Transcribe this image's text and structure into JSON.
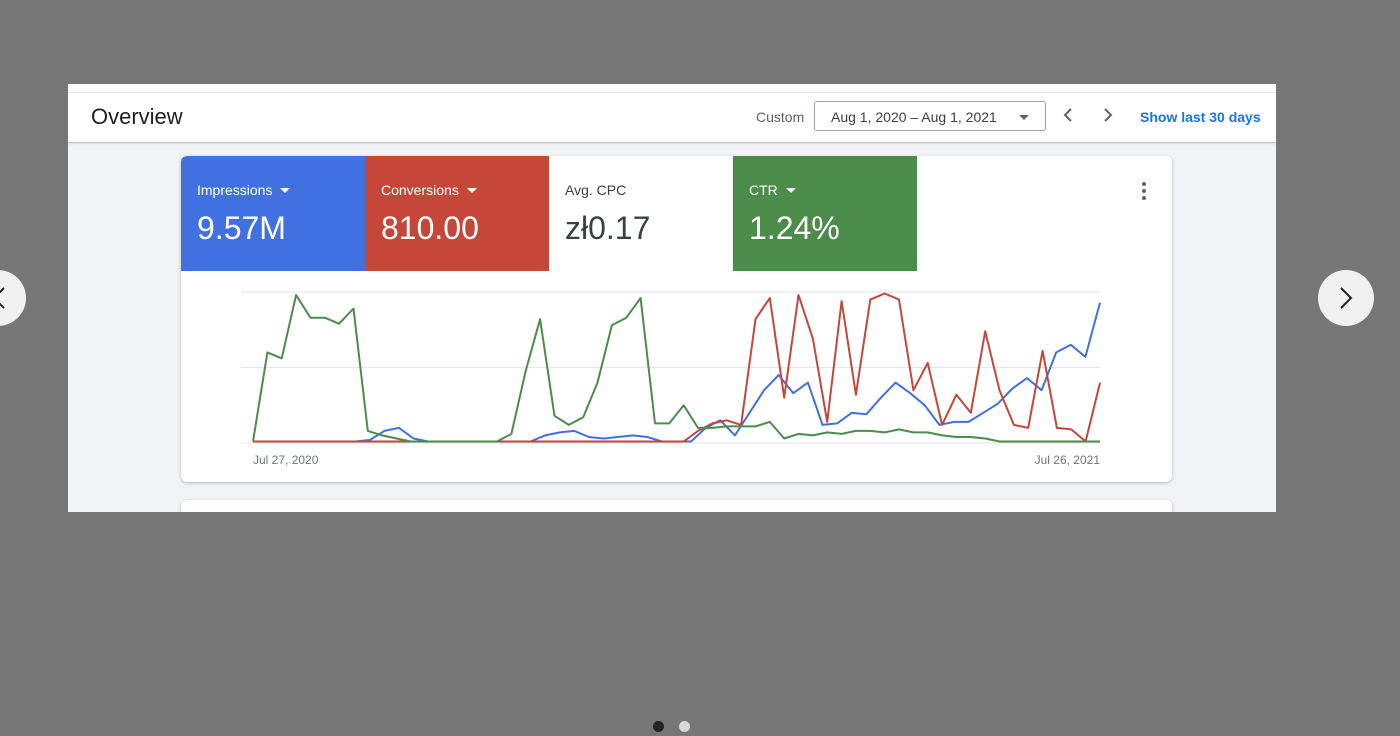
{
  "header": {
    "title": "Overview",
    "custom_label": "Custom",
    "date_range": "Aug 1, 2020 – Aug 1, 2021",
    "show_last": "Show last 30 days"
  },
  "metrics": [
    {
      "label": "Impressions",
      "value": "9.57M",
      "color": "#4170e0",
      "has_dropdown": true
    },
    {
      "label": "Conversions",
      "value": "810.00",
      "color": "#c5473a",
      "has_dropdown": true
    },
    {
      "label": "Avg. CPC",
      "value": "zł0.17",
      "color": "#ffffff",
      "has_dropdown": false
    },
    {
      "label": "CTR",
      "value": "1.24%",
      "color": "#4b8c4a",
      "has_dropdown": true
    }
  ],
  "chart_data": {
    "type": "line",
    "x_start_label": "Jul 27, 2020",
    "x_end_label": "Jul 26, 2021",
    "ylim": [
      0,
      100
    ],
    "grid": true,
    "series": [
      {
        "color": "#4170e0",
        "values": [
          1,
          1,
          1,
          1,
          1,
          1,
          1,
          1,
          2,
          8,
          10,
          3,
          1,
          1,
          1,
          1,
          1,
          1,
          1,
          1,
          5,
          7,
          8,
          4,
          3,
          4,
          5,
          4,
          1,
          1,
          1,
          10,
          15,
          5,
          20,
          35,
          45,
          33,
          40,
          12,
          13,
          20,
          19,
          30,
          40,
          33,
          25,
          12,
          14,
          14,
          20,
          26,
          36,
          43,
          35,
          60,
          65,
          57,
          93
        ]
      },
      {
        "color": "#c5473a",
        "values": [
          1,
          1,
          1,
          1,
          1,
          1,
          1,
          1,
          1,
          1,
          1,
          1,
          1,
          1,
          1,
          1,
          1,
          1,
          1,
          1,
          1,
          1,
          1,
          1,
          1,
          1,
          1,
          1,
          1,
          1,
          1,
          8,
          13,
          15,
          12,
          82,
          96,
          30,
          98,
          69,
          14,
          94,
          32,
          95,
          99,
          95,
          35,
          53,
          12,
          32,
          20,
          74,
          35,
          12,
          10,
          61,
          10,
          9,
          1,
          40
        ]
      },
      {
        "color": "#4b8c4a",
        "values": [
          1,
          60,
          56,
          98,
          83,
          83,
          79,
          89,
          8,
          5,
          3,
          1,
          1,
          1,
          1,
          1,
          1,
          1,
          6,
          48,
          82,
          18,
          12,
          17,
          40,
          78,
          83,
          96,
          13,
          13,
          25,
          10,
          10,
          11,
          11,
          11,
          14,
          3,
          6,
          5,
          7,
          6,
          8,
          8,
          7,
          9,
          7,
          7,
          5,
          4,
          4,
          3,
          1,
          1,
          1,
          1,
          1,
          1,
          1,
          1
        ]
      }
    ]
  },
  "carousel": {
    "dots": 2,
    "active": 0
  }
}
